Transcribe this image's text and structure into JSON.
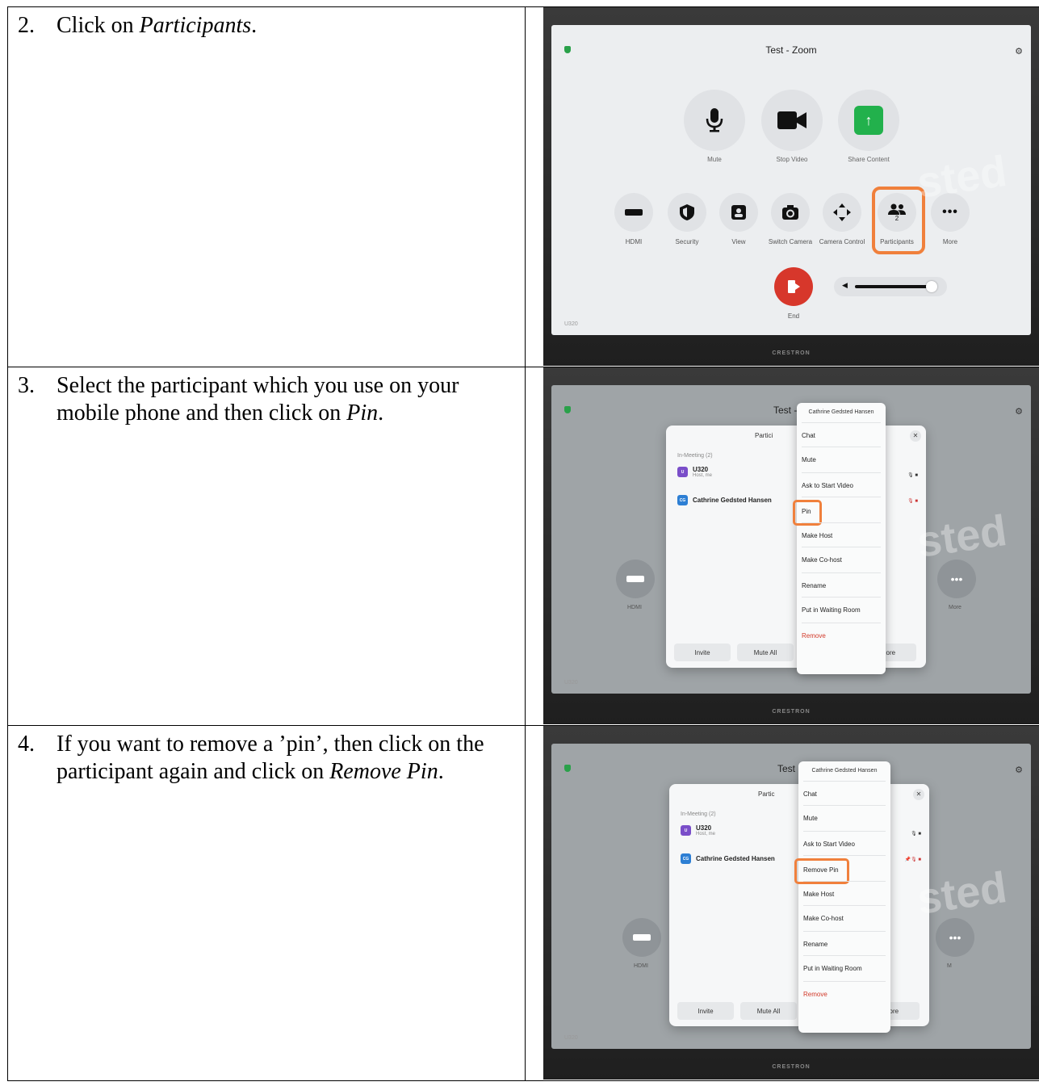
{
  "steps": [
    {
      "number": "2.",
      "text_parts": [
        "Click on ",
        "Participants",
        "."
      ],
      "screen": {
        "title": "Test - Zoom",
        "room": "U320",
        "brand": "CRESTRON",
        "glare_text": "sted",
        "big_buttons": [
          {
            "label": "Mute",
            "icon": "microphone-icon"
          },
          {
            "label": "Stop Video",
            "icon": "video-camera-icon"
          },
          {
            "label": "Share Content",
            "icon": "share-arrow-icon"
          }
        ],
        "small_buttons": [
          {
            "label": "HDMI",
            "icon": "hdmi-icon"
          },
          {
            "label": "Security",
            "icon": "shield-icon"
          },
          {
            "label": "View",
            "icon": "person-view-icon"
          },
          {
            "label": "Switch Camera",
            "icon": "camera-rotate-icon"
          },
          {
            "label": "Camera Control",
            "icon": "arrows-move-icon"
          },
          {
            "label": "Participants",
            "icon": "people-icon",
            "badge": "2"
          },
          {
            "label": "More",
            "icon": "ellipsis-icon"
          }
        ],
        "end_label": "End"
      }
    },
    {
      "number": "3.",
      "text_parts": [
        "Select the participant which you use on your mobile phone and then click on ",
        "Pin",
        "."
      ],
      "screen": {
        "title_part": "Test -",
        "dialog_title": "Partici",
        "in_meeting": "In-Meeting (2)",
        "participants": [
          {
            "name": "U320",
            "sub": "Host, me",
            "avatar": "U",
            "color": "#7a4ec9"
          },
          {
            "name": "Cathrine Gedsted Hansen",
            "sub": "",
            "avatar": "CG",
            "color": "#2d7fd4"
          }
        ],
        "menu_header": "Cathrine Gedsted Hansen",
        "menu_items": [
          "Chat",
          "Mute",
          "Ask to Start Video",
          "Pin",
          "Make Host",
          "Make Co-host",
          "Rename",
          "Put in Waiting Room",
          "Remove"
        ],
        "buttons": [
          "Invite",
          "Mute All",
          "More"
        ],
        "side_left": "HDMI",
        "side_right": "More",
        "room": "U320",
        "brand": "CRESTRON",
        "glare_text": "sted"
      }
    },
    {
      "number": "4.",
      "text_parts": [
        "If you want to remove a ’pin’, then click on the participant again and click on ",
        "Remove Pin",
        "."
      ],
      "screen": {
        "title_part": "Test",
        "dialog_title": "Partic",
        "in_meeting": "In-Meeting (2)",
        "participants": [
          {
            "name": "U320",
            "sub": "Host, me",
            "avatar": "U",
            "color": "#7a4ec9"
          },
          {
            "name": "Cathrine Gedsted Hansen",
            "sub": "",
            "avatar": "CG",
            "color": "#2d7fd4"
          }
        ],
        "menu_header": "Cathrine Gedsted Hansen",
        "menu_items": [
          "Chat",
          "Mute",
          "Ask to Start Video",
          "Remove Pin",
          "Make Host",
          "Make Co-host",
          "Rename",
          "Put in Waiting Room",
          "Remove"
        ],
        "buttons": [
          "Invite",
          "Mute All",
          "More"
        ],
        "side_left": "HDMI",
        "side_right": "M",
        "room": "U320",
        "brand": "CRESTRON",
        "glare_text": "sted"
      }
    }
  ],
  "colors": {
    "highlight": "#f0803c",
    "share_green": "#22b14c",
    "end_red": "#d7372b",
    "remove_red": "#d23a2a"
  }
}
